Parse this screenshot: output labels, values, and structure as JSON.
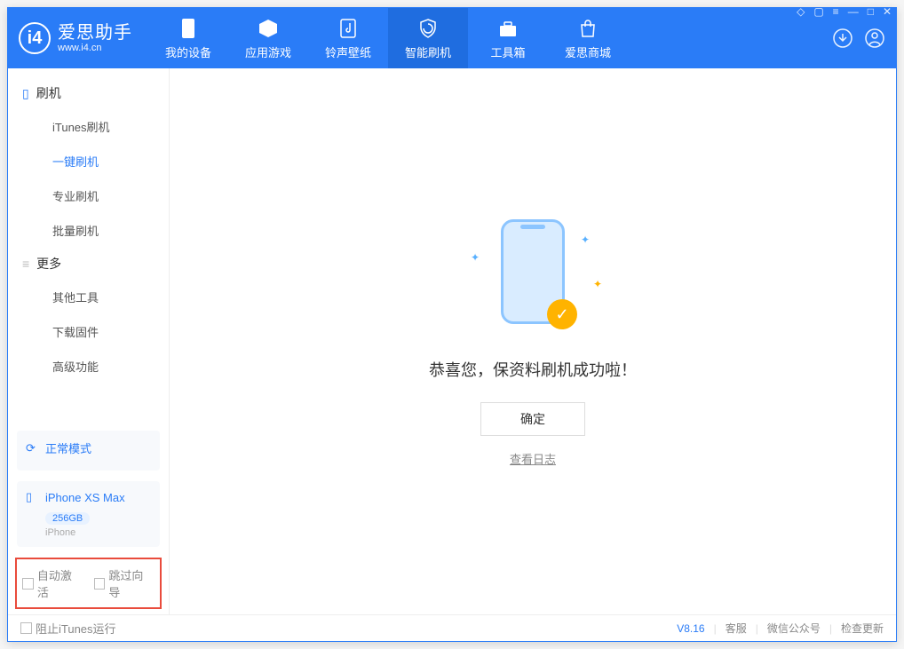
{
  "app": {
    "title": "爱思助手",
    "subtitle": "www.i4.cn"
  },
  "nav": {
    "items": [
      {
        "label": "我的设备"
      },
      {
        "label": "应用游戏"
      },
      {
        "label": "铃声壁纸"
      },
      {
        "label": "智能刷机"
      },
      {
        "label": "工具箱"
      },
      {
        "label": "爱思商城"
      }
    ],
    "activeIndex": 3
  },
  "sidebar": {
    "group1": {
      "label": "刷机"
    },
    "items1": [
      {
        "label": "iTunes刷机"
      },
      {
        "label": "一键刷机"
      },
      {
        "label": "专业刷机"
      },
      {
        "label": "批量刷机"
      }
    ],
    "activeItem": 1,
    "group2": {
      "label": "更多"
    },
    "items2": [
      {
        "label": "其他工具"
      },
      {
        "label": "下载固件"
      },
      {
        "label": "高级功能"
      }
    ],
    "mode": {
      "label": "正常模式"
    },
    "device": {
      "name": "iPhone XS Max",
      "capacity": "256GB",
      "type": "iPhone"
    },
    "options": {
      "autoActivate": "自动激活",
      "skipGuide": "跳过向导"
    }
  },
  "main": {
    "successText": "恭喜您，保资料刷机成功啦！",
    "okButton": "确定",
    "logLink": "查看日志"
  },
  "statusbar": {
    "blockItunes": "阻止iTunes运行",
    "version": "V8.16",
    "links": [
      "客服",
      "微信公众号",
      "检查更新"
    ]
  }
}
